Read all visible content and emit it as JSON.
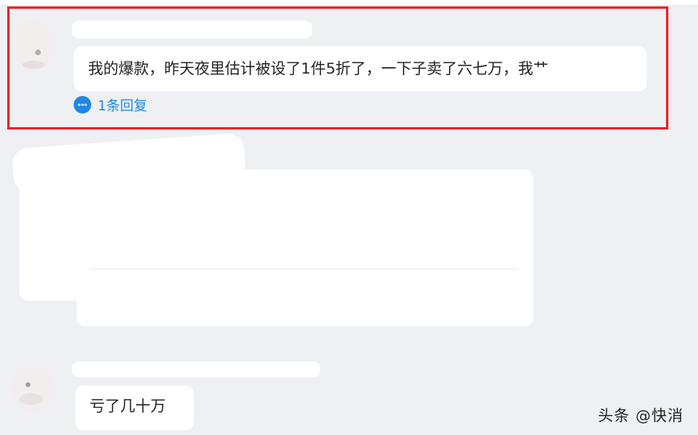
{
  "comments": [
    {
      "text": "我的爆款，昨天夜里估计被设了1件5折了，一下子卖了六七万，我艹",
      "reply_count_label": "1条回复"
    },
    {
      "text": "亏了几十万"
    }
  ],
  "watermark": "头条 @快消",
  "colors": {
    "highlight": "#e8262b",
    "link": "#1e88e5",
    "background": "#eef0f4"
  },
  "icons": [
    "reply-bubble-icon",
    "avatar"
  ]
}
